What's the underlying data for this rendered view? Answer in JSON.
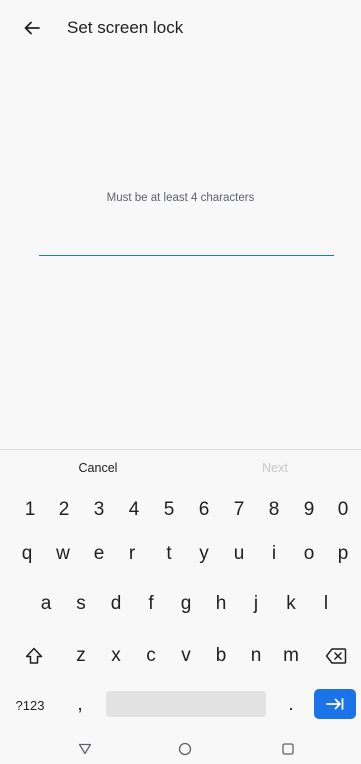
{
  "app_bar": {
    "title": "Set screen lock"
  },
  "hint": "Must be at least 4 characters",
  "password_input": {
    "value": ""
  },
  "actions": {
    "cancel": "Cancel",
    "next": "Next"
  },
  "keyboard": {
    "row1": [
      "1",
      "2",
      "3",
      "4",
      "5",
      "6",
      "7",
      "8",
      "9",
      "0"
    ],
    "row2": [
      "q",
      "w",
      "e",
      "r",
      "t",
      "y",
      "u",
      "i",
      "o",
      "p"
    ],
    "row3": [
      "a",
      "s",
      "d",
      "f",
      "g",
      "h",
      "j",
      "k",
      "l"
    ],
    "row4": [
      "z",
      "x",
      "c",
      "v",
      "b",
      "n",
      "m"
    ],
    "symbols_key": "?123",
    "comma_key": ",",
    "period_key": "."
  },
  "colors": {
    "accent": "#1a73e8",
    "background": "#f8f8f8"
  },
  "icons": [
    "back-arrow-icon",
    "shift-icon",
    "backspace-icon",
    "enter-icon",
    "nav-back-icon",
    "nav-home-icon",
    "nav-recents-icon"
  ]
}
